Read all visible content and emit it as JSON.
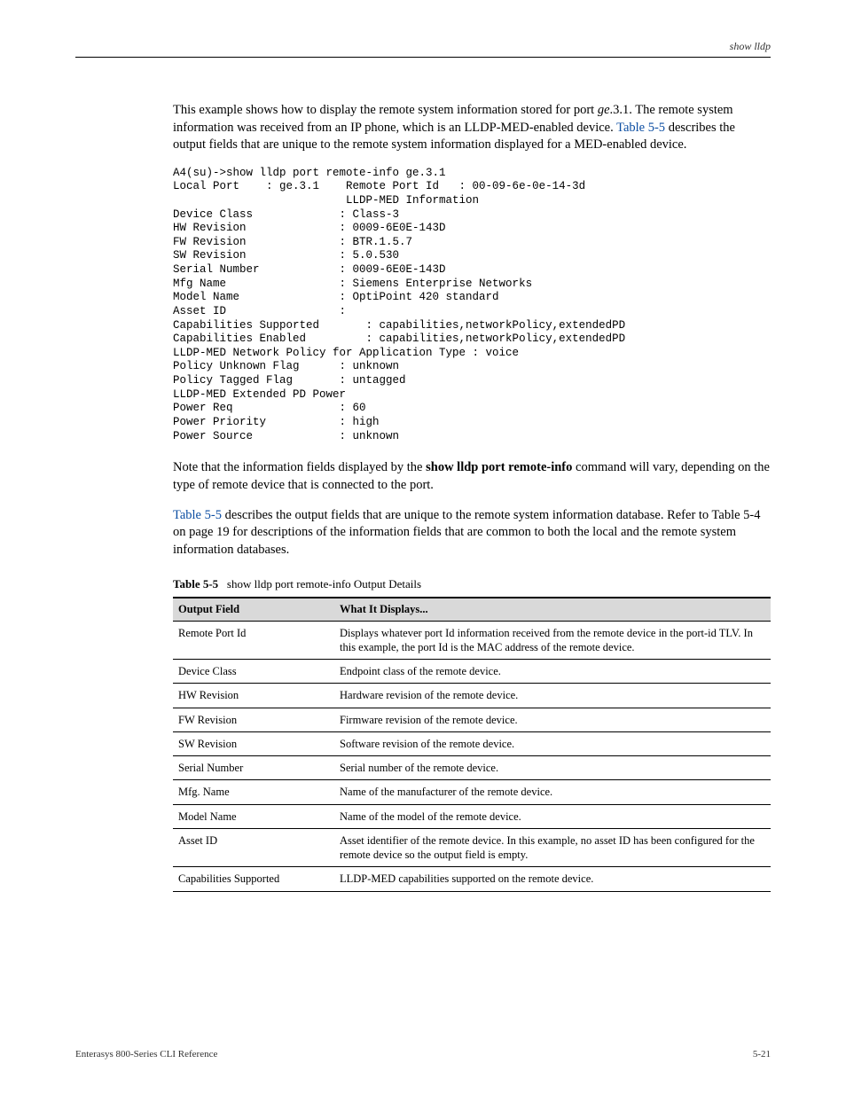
{
  "header": {
    "right": "show lldp"
  },
  "intro": {
    "p1a": "This example shows how to display the remote system information stored for port ",
    "p1b": "ge",
    "p1c": ".3.1. The remote system information was received from an IP phone, which is an LLDP-MED-enabled device. ",
    "link1": "Table 5-5",
    "p1d": " describes the output fields that are unique to the remote system information displayed for a MED-enabled device."
  },
  "cli": {
    "line01": "A4(su)->show lldp port remote-info ge.3.1",
    "line02": "Local Port    : ge.3.1    Remote Port Id   : 00-09-6e-0e-14-3d",
    "line03": "                          LLDP-MED Information",
    "line04": "Device Class             : Class-3",
    "line05": "HW Revision              : 0009-6E0E-143D",
    "line06": "FW Revision              : BTR.1.5.7",
    "line07": "SW Revision              : 5.0.530",
    "line08": "Serial Number            : 0009-6E0E-143D",
    "line09": "Mfg Name                 : Siemens Enterprise Networks",
    "line10": "Model Name               : OptiPoint 420 standard",
    "line11": "Asset ID                 :",
    "line12": "Capabilities Supported       : capabilities,networkPolicy,extendedPD",
    "line13": "Capabilities Enabled         : capabilities,networkPolicy,extendedPD",
    "line14": "LLDP-MED Network Policy for Application Type : voice",
    "line15": "Policy Unknown Flag      : unknown",
    "line16": "Policy Tagged Flag       : untagged",
    "line17": "LLDP-MED Extended PD Power",
    "line18": "Power Req                : 60",
    "line19": "Power Priority           : high",
    "line20": "Power Source             : unknown"
  },
  "para2": {
    "a": "Note that the information fields displayed by the ",
    "cmd": "show lldp port remote-info",
    "b": " command will vary, depending on the type of remote device that is connected to the port."
  },
  "para3": {
    "link": "Table 5-5",
    "a": " describes the output fields that are unique to the remote system information database. Refer to Table 5-4 on page 19 for descriptions of the information fields that are common to both the local and the remote system information databases."
  },
  "table": {
    "caption_prefix": "Table 5-5",
    "caption": "show lldp port remote-info Output Details",
    "head1": "Output Field",
    "head2": "What It Displays...",
    "rows": [
      {
        "f": "Remote Port Id",
        "d": "Displays whatever port Id information received from the remote device in the port-id TLV. In this example, the port Id is the MAC address of the remote device."
      },
      {
        "f": "Device Class",
        "d": "Endpoint class of the remote device."
      },
      {
        "f": "HW Revision",
        "d": "Hardware revision of the remote device."
      },
      {
        "f": "FW Revision",
        "d": "Firmware revision of the remote device."
      },
      {
        "f": "SW Revision",
        "d": "Software revision of the remote device."
      },
      {
        "f": "Serial Number",
        "d": "Serial number of the remote device."
      },
      {
        "f": "Mfg. Name",
        "d": "Name of the manufacturer of the remote device."
      },
      {
        "f": "Model Name",
        "d": "Name of the model of the remote device."
      },
      {
        "f": "Asset ID",
        "d": "Asset identifier of the remote device. In this example, no asset ID has been configured for the remote device so the output field is empty."
      },
      {
        "f": "Capabilities Supported",
        "d": "LLDP-MED capabilities supported on the remote device."
      }
    ]
  },
  "footer": {
    "left": "Enterasys 800-Series CLI Reference",
    "right": "5-21"
  }
}
